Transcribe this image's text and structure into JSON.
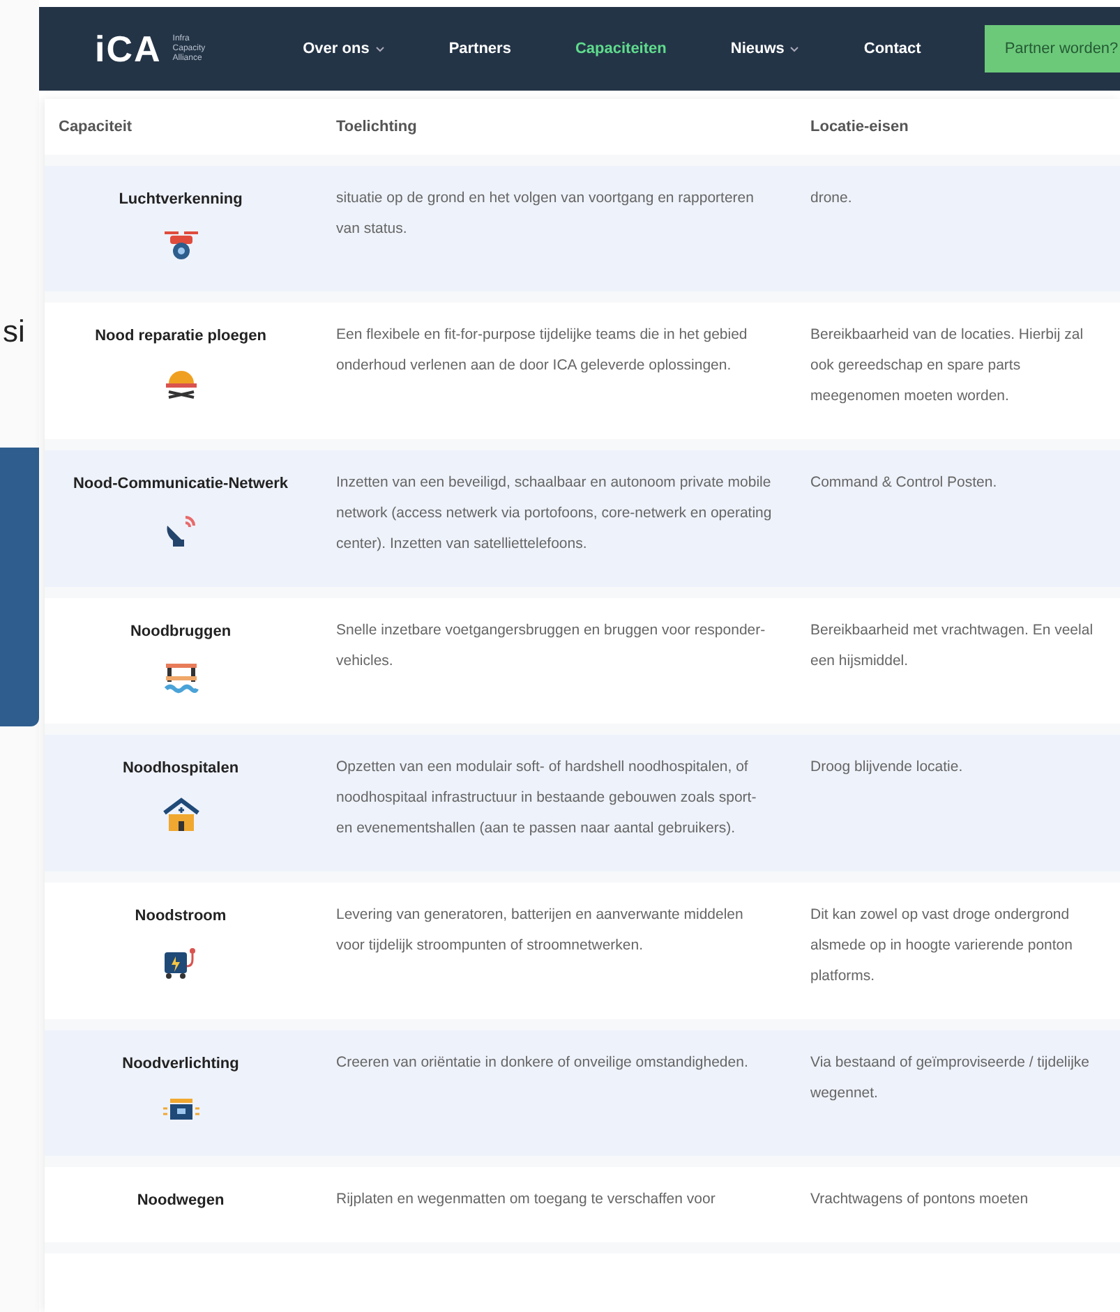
{
  "background_page": {
    "heading_fragment": "si"
  },
  "nav": {
    "logo": "iCA",
    "logo_tagline": "Infra Capacity Alliance",
    "items": [
      {
        "label": "Over ons",
        "dropdown": true,
        "selected": false
      },
      {
        "label": "Partners",
        "dropdown": false,
        "selected": false
      },
      {
        "label": "Capaciteiten",
        "dropdown": false,
        "selected": true
      },
      {
        "label": "Nieuws",
        "dropdown": true,
        "selected": false
      },
      {
        "label": "Contact",
        "dropdown": false,
        "selected": false
      }
    ],
    "cta": "Partner worden?"
  },
  "table": {
    "columns": [
      "Capaciteit",
      "Toelichting",
      "Locatie-eisen"
    ],
    "rows": [
      {
        "capacity": "Luchtverkenning",
        "description": "situatie op de grond en het volgen van voortgang en rapporteren van status.",
        "location": "drone."
      },
      {
        "capacity": "Nood reparatie ploegen",
        "description": "Een flexibele en fit-for-purpose tijdelijke teams die in het gebied onderhoud verlenen aan de door ICA geleverde oplossingen.",
        "location": "Bereikbaarheid van de locaties. Hierbij zal ook gereedschap en spare parts meegenomen moeten worden."
      },
      {
        "capacity": "Nood-Communicatie-Netwerk",
        "description": "Inzetten van een beveiligd, schaalbaar en autonoom private mobile network (access netwerk via portofoons, core-netwerk en operating center). Inzetten van satelliettelefoons.",
        "location": "Command & Control Posten."
      },
      {
        "capacity": "Noodbruggen",
        "description": "Snelle inzetbare voetgangersbruggen en bruggen voor responder-vehicles.",
        "location": "Bereikbaarheid met vrachtwagen. En veelal een hijsmiddel."
      },
      {
        "capacity": "Noodhospitalen",
        "description": "Opzetten van een modulair soft- of hardshell noodhospitalen, of noodhospitaal infrastructuur in bestaande gebouwen zoals sport- en evenementshallen (aan te passen naar aantal gebruikers).",
        "location": "Droog blijvende locatie."
      },
      {
        "capacity": "Noodstroom",
        "description": "Levering van generatoren, batterijen en aanverwante middelen voor tijdelijk stroompunten of stroomnetwerken.",
        "location": "Dit kan zowel op vast droge ondergrond alsmede op in hoogte varierende ponton platforms."
      },
      {
        "capacity": "Noodverlichting",
        "description": "Creeren van oriëntatie in donkere of onveilige omstandigheden.",
        "location": "Via bestaand of geïmproviseerde / tijdelijke wegennet."
      },
      {
        "capacity": "Noodwegen",
        "description": "Rijplaten en wegenmatten om toegang te verschaffen voor",
        "location": "Vrachtwagens of pontons moeten"
      }
    ]
  }
}
